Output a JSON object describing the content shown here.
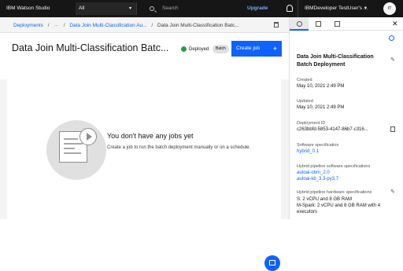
{
  "topbar": {
    "brand": "IBM Watson Studio",
    "scope": "All",
    "search_placeholder": "Search",
    "upgrade": "Upgrade",
    "account": "IBMDeveloper TestUser's ...",
    "avatar_initials": "IT"
  },
  "breadcrumbs": {
    "items": [
      "Deployments",
      "/",
      "···",
      "/",
      "Data Join Multi-Classification Au...",
      "/",
      "Data Join Multi-Classification Batc..."
    ]
  },
  "header": {
    "title": "Data Join Multi-Classification Batc...",
    "status": "Deployed",
    "tag": "Batch",
    "create_button": "Create job",
    "create_icon": "+"
  },
  "empty_state": {
    "title": "You don't have any jobs yet",
    "description": "Create a job to run the batch deployment manually or on a schedule."
  },
  "panel": {
    "close_icon": "✕",
    "title": "Data Join Multi-Classification Batch Deployment",
    "created_label": "Created",
    "created_value": "May 10, 2021 2:49 PM",
    "updated_label": "Updated",
    "updated_value": "May 10, 2021 2:49 PM",
    "id_label": "Deployment ID",
    "id_value": "c263bbfd-5853-4147-86b7-c316...",
    "software_label": "Software specification",
    "software_value": "hybrid_0.1",
    "hybrid_sw_label": "Hybrid pipeline software specifications",
    "hybrid_sw_values": [
      "autoai-obm_2.0",
      "autoai-kb_3.3-py3.7"
    ],
    "hybrid_hw_label": "Hybrid pipeline hardware specifications",
    "hybrid_hw_line1": "S: 2 vCPU and 8 GB RAM",
    "hybrid_hw_line2": "M-Spark: 2 vCPU and 8 GB RAM with 4",
    "hybrid_hw_line3": "executors"
  },
  "colors": {
    "accent": "#0f62fe",
    "topbar": "#161616",
    "deployed": "#24a148"
  }
}
